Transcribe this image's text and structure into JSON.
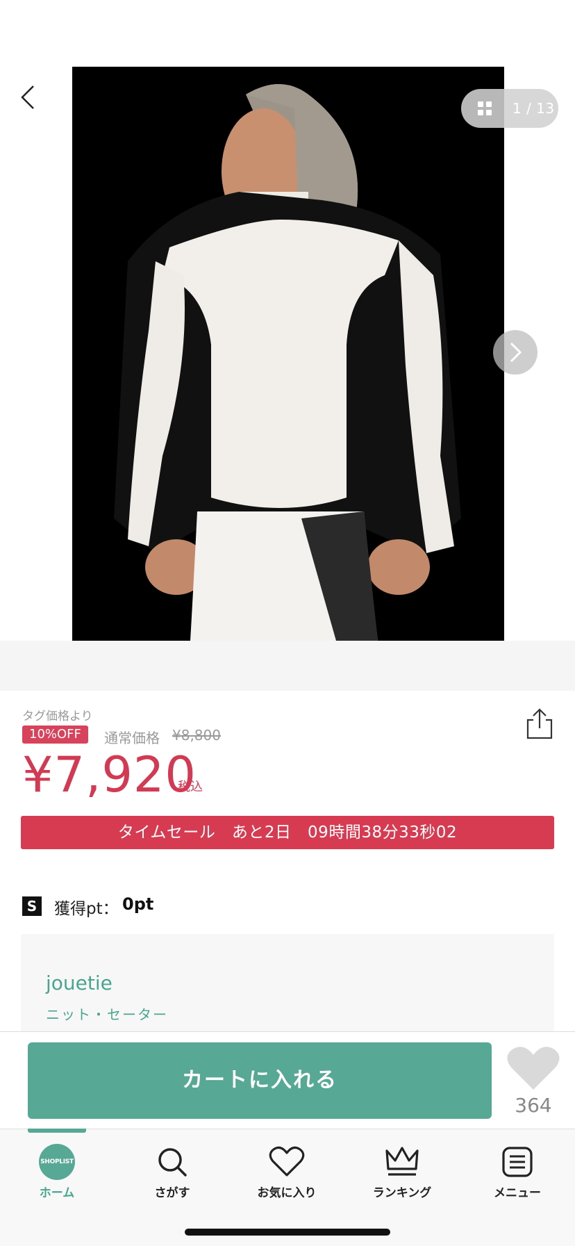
{
  "gallery": {
    "counter": "1 / 13"
  },
  "price": {
    "tag_label": "タグ価格より",
    "discount_badge": "10%OFF",
    "regular_label": "通常価格",
    "regular_price": "¥8,800",
    "sale_price": "¥7,920",
    "tax_label": "税込"
  },
  "timesale": {
    "text": "タイムセール　あと2日　09時間38分33秒02"
  },
  "points": {
    "icon_letter": "S",
    "label": "獲得pt：",
    "value": "0pt"
  },
  "brand": {
    "name": "jouetie",
    "category": "ニット・セーター"
  },
  "actions": {
    "cart_label": "カートに入れる",
    "favorite_count": "364"
  },
  "tabs": [
    {
      "label": "ホーム",
      "icon": "shoplist-logo-icon",
      "logo_text": "SHOPLIST"
    },
    {
      "label": "さがす",
      "icon": "search-icon"
    },
    {
      "label": "お気に入り",
      "icon": "heart-icon"
    },
    {
      "label": "ランキング",
      "icon": "crown-icon"
    },
    {
      "label": "メニュー",
      "icon": "menu-icon"
    }
  ],
  "colors": {
    "accent_green": "#58a896",
    "sale_red": "#d23a54",
    "timesale_red": "#d63b52"
  }
}
